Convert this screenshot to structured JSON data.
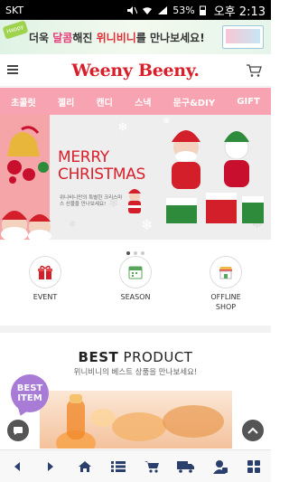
{
  "status_bar": {
    "carrier": "SKT",
    "battery": "53%",
    "time": "오후 2:13"
  },
  "promo_banner": {
    "tag": "Happy",
    "text_prefix": "더욱 ",
    "text_pink": "달콤",
    "text_mid": "해진 ",
    "text_red": "위니비니",
    "text_suffix": "를 만나보세요!"
  },
  "header": {
    "logo": "Weeny Beeny."
  },
  "categories": [
    {
      "label": "초콜릿"
    },
    {
      "label": "젤리"
    },
    {
      "label": "캔디"
    },
    {
      "label": "스낵"
    },
    {
      "label": "문구&DIY"
    },
    {
      "label": "GIFT"
    }
  ],
  "hero": {
    "title_line1": "MERRY",
    "title_line2": "CHRISTMAS",
    "subtitle": "위니비니만의 특별한 크리스마스 선물을 만나보세요!",
    "page_count": 3,
    "active_page": 1
  },
  "quick_links": [
    {
      "label": "EVENT"
    },
    {
      "label": "SEASON"
    },
    {
      "label": "OFFLINE SHOP"
    }
  ],
  "best_product": {
    "title_bold": "BEST",
    "title_rest": " PRODUCT",
    "subtitle": "위니비니의 베스트 상품을 만나보세요!",
    "badge_line1": "BEST",
    "badge_line2": "ITEM"
  },
  "colors": {
    "brand_red": "#d91e2a",
    "nav_pink": "#f7a3b1",
    "badge_purple": "#a77bd6"
  }
}
